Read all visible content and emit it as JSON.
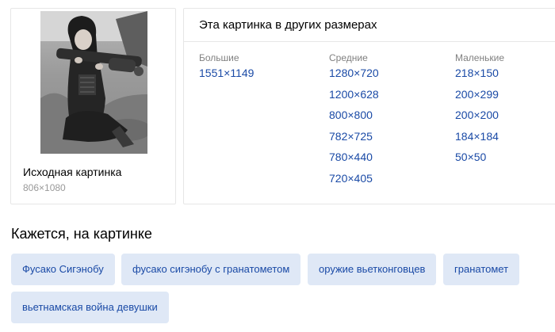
{
  "source": {
    "title": "Исходная картинка",
    "size": "806×1080"
  },
  "sizes": {
    "header": "Эта картинка в других размерах",
    "columns": [
      {
        "label": "Большие",
        "items": [
          "1551×1149"
        ]
      },
      {
        "label": "Средние",
        "items": [
          "1280×720",
          "1200×628",
          "800×800",
          "782×725",
          "780×440",
          "720×405"
        ]
      },
      {
        "label": "Маленькие",
        "items": [
          "218×150",
          "200×299",
          "200×200",
          "184×184",
          "50×50"
        ]
      }
    ]
  },
  "tags": {
    "title": "Кажется, на картинке",
    "items": [
      "Фусако Сигэнобу",
      "фусако сигэнобу с гранатометом",
      "оружие вьетконговцев",
      "гранатомет",
      "вьетнамская война девушки"
    ]
  },
  "colors": {
    "link": "#1a4aa6",
    "tag_background": "#dfe8f6",
    "muted": "#999999"
  }
}
